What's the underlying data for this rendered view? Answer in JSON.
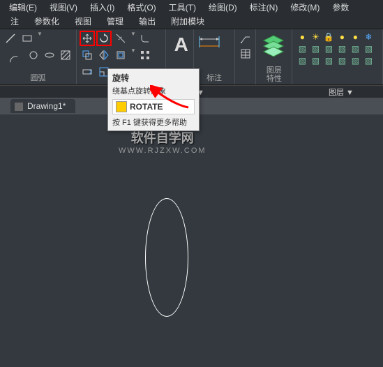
{
  "menu": {
    "edit": "编辑(E)",
    "view": "视图(V)",
    "insert": "插入(I)",
    "format": "格式(O)",
    "tools": "工具(T)",
    "draw": "绘图(D)",
    "dimension": "标注(N)",
    "modify": "修改(M)",
    "param": "参数"
  },
  "tabs": {
    "t1": "注",
    "param": "参数化",
    "view": "视图",
    "manage": "管理",
    "output": "输出",
    "addon": "附加模块"
  },
  "ribbon": {
    "arc": "圆弧",
    "annotate_dropdown": "释 ▼",
    "dimension": "标注",
    "layer_props": "图层\n特性",
    "layer": "图层 ▼"
  },
  "tooltip": {
    "title": "旋转",
    "desc": "绕基点旋转对象",
    "cmd": "ROTATE",
    "help": "按 F1 键获得更多帮助"
  },
  "doc": {
    "tab": "Drawing1*"
  },
  "watermark": {
    "line1": "软件自学网",
    "line2": "WWW.RJZXW.COM"
  },
  "chart_data": null
}
